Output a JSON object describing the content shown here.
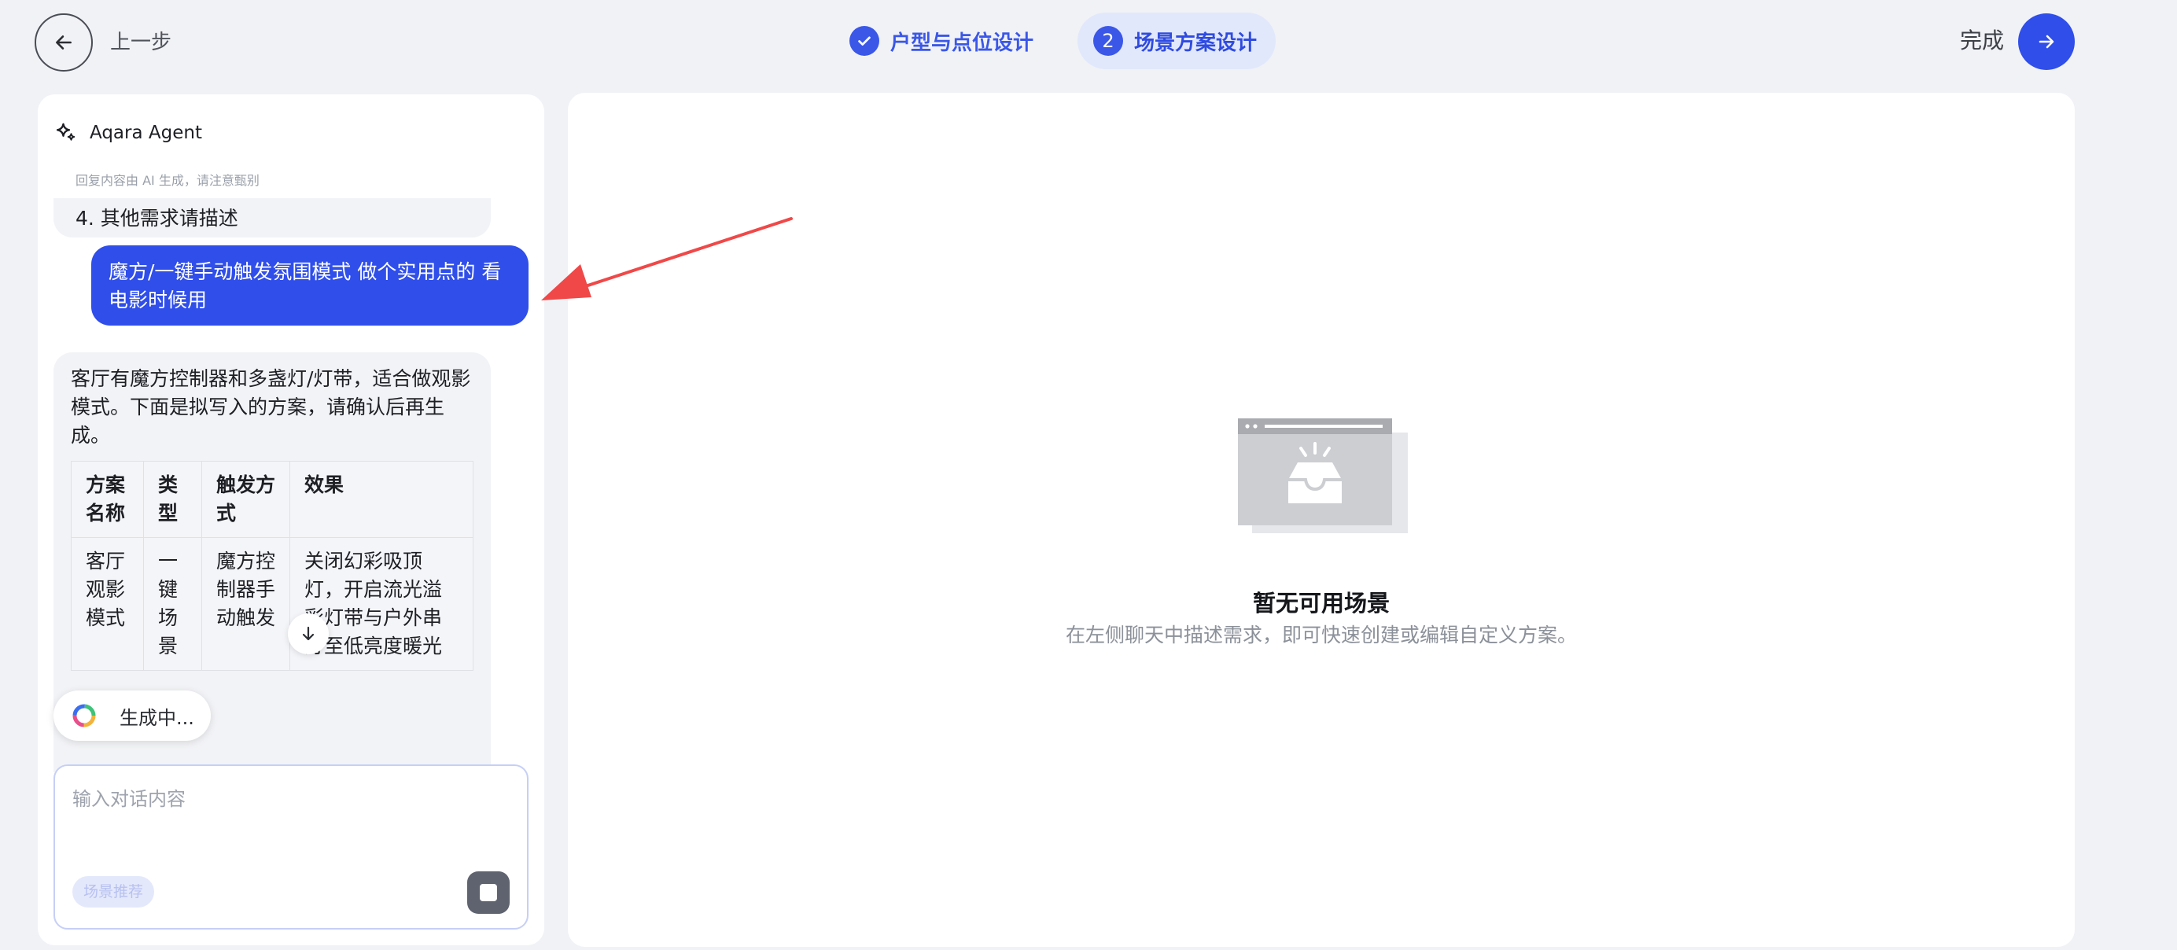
{
  "header": {
    "back_label": "上一步",
    "steps": [
      {
        "label": "户型与点位设计",
        "status": "completed"
      },
      {
        "number": "2",
        "label": "场景方案设计",
        "status": "active"
      }
    ],
    "done_label": "完成"
  },
  "chat": {
    "agent_name": "Aqara Agent",
    "disclaimer": "回复内容由 AI 生成，请注意甄别",
    "prev_bot_tail": "4. 其他需求请描述",
    "user_message": "魔方/一键手动触发氛围模式 做个实用点的 看电影时候用",
    "bot_message": "客厅有魔方控制器和多盏灯/灯带，适合做观影模式。下面是拟写入的方案，请确认后再生成。",
    "table": {
      "headers": [
        "方案名称",
        "类型",
        "触发方式",
        "效果"
      ],
      "rows": [
        [
          "客厅观影模式",
          "一键场景",
          "魔方控制器手动触发",
          "关闭幻彩吸顶灯，开启流光溢彩灯带与户外串灯至低亮度暖光"
        ]
      ]
    },
    "generating_label": "生成中...",
    "input_placeholder": "输入对话内容",
    "scene_chip_label": "场景推荐"
  },
  "scenes": {
    "empty_title": "暂无可用场景",
    "empty_desc": "在左侧聊天中描述需求，即可快速创建或编辑自定义方案。"
  },
  "colors": {
    "accent": "#2f4eea",
    "annotation_arrow": "#f04848"
  },
  "icons": [
    "arrow-left-icon",
    "check-icon",
    "arrow-right-icon",
    "sparkle-icon",
    "arrow-down-icon",
    "spinner-icon",
    "stop-icon",
    "empty-inbox-illustration"
  ]
}
